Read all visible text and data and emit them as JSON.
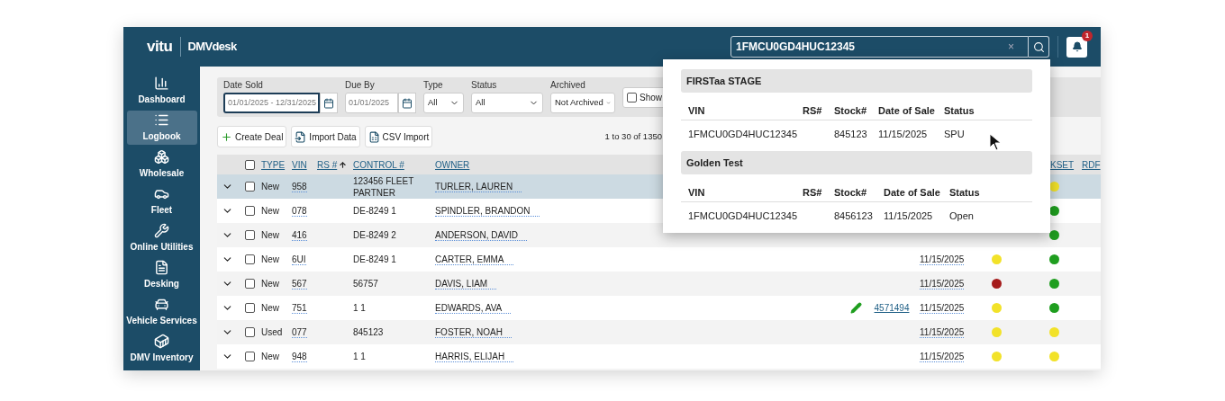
{
  "header": {
    "logo": "vitu",
    "product": "DMVdesk",
    "search": {
      "value": "1FMCU0GD4HUC12345",
      "clear": "×"
    },
    "notifications": {
      "count": "1"
    }
  },
  "sidebar": {
    "items": [
      {
        "label": "Dashboard",
        "selected": false
      },
      {
        "label": "Logbook",
        "selected": true
      },
      {
        "label": "Wholesale",
        "selected": false
      },
      {
        "label": "Fleet",
        "selected": false
      },
      {
        "label": "Online Utilities",
        "selected": false
      },
      {
        "label": "Desking",
        "selected": false
      },
      {
        "label": "Vehicle Services",
        "selected": false
      },
      {
        "label": "DMV Inventory",
        "selected": false
      }
    ]
  },
  "filters": [
    {
      "kind": "date",
      "label": "Date Sold",
      "value": "01/01/2025 - 12/31/2025",
      "focused": true
    },
    {
      "kind": "date",
      "label": "Due By",
      "value": "01/01/2025",
      "focused": false
    },
    {
      "kind": "select",
      "label": "Type",
      "value": "All"
    },
    {
      "kind": "select",
      "label": "Status",
      "value": "All"
    },
    {
      "kind": "select",
      "label": "Archived",
      "value": "Not Archived"
    },
    {
      "kind": "checkbox",
      "label": "Show",
      "checked": false
    }
  ],
  "actions": [
    {
      "label": "Create Deal"
    },
    {
      "label": "Import Data"
    },
    {
      "label": "CSV Import"
    }
  ],
  "pagination": "1 to 30 of 1350",
  "table": {
    "all_checked": false,
    "columns": [
      {
        "label": "TYPE"
      },
      {
        "label": "VIN"
      },
      {
        "label": "RS #",
        "sorted": true
      },
      {
        "label": "CONTROL #"
      },
      {
        "label": "OWNER"
      },
      {
        "label": "KSET"
      },
      {
        "label": "RDF"
      }
    ],
    "rows": [
      {
        "selected": true,
        "checked": false,
        "type": "New",
        "vin": "958",
        "control": "123456 FLEET PARTNER",
        "owner": "TURLER, LAUREN",
        "dot_2": {
          "color": "#f2e229"
        }
      },
      {
        "selected": false,
        "checked": false,
        "type": "New",
        "vin": "078",
        "control": "DE-8249 1",
        "owner": "SPINDLER, BRANDON",
        "dot_2": {
          "color": "#1f9e1f"
        }
      },
      {
        "selected": false,
        "checked": false,
        "type": "New",
        "vin": "416",
        "control": "DE-8249 2",
        "owner": "ANDERSON, DAVID",
        "dot_2": {
          "color": "#1f9e1f"
        }
      },
      {
        "selected": false,
        "checked": false,
        "type": "New",
        "vin": "6UI",
        "control": "DE-8249 1",
        "owner": "CARTER, EMMA",
        "date": "11/15/2025",
        "dot_1": {
          "color": "#f2e229"
        },
        "dot_2": {
          "color": "#1f9e1f"
        }
      },
      {
        "selected": false,
        "checked": false,
        "type": "New",
        "vin": "567",
        "control": "56757",
        "owner": "DAVIS, LIAM",
        "date": "11/15/2025",
        "dot_1": {
          "color": "#a51b1b"
        },
        "dot_2": {
          "color": "#1f9e1f"
        }
      },
      {
        "selected": false,
        "checked": false,
        "type": "New",
        "vin": "751",
        "control": "1 1",
        "owner": "EDWARDS, AVA",
        "editable": true,
        "link": "4571494",
        "date": "11/15/2025",
        "dot_1": {
          "color": "#f2e229"
        },
        "dot_2": {
          "color": "#1f9e1f"
        }
      },
      {
        "selected": false,
        "checked": false,
        "type": "Used",
        "vin": "077",
        "control": "845123",
        "owner": "FOSTER, NOAH",
        "date": "11/15/2025",
        "dot_1": {
          "color": "#f2e229"
        },
        "dot_2": {
          "color": "#f2e229"
        }
      },
      {
        "selected": false,
        "checked": false,
        "type": "New",
        "vin": "948",
        "control": "1 1",
        "owner": "HARRIS, ELIJAH",
        "date": "11/15/2025",
        "dot_1": {
          "color": "#f2e229"
        },
        "dot_2": {
          "color": "#f2e229"
        }
      }
    ]
  },
  "search_results": [
    {
      "title": "FIRSTaa STAGE",
      "columns": [
        "VIN",
        "RS#",
        "Stock#",
        "Date of Sale",
        "Status"
      ],
      "row": {
        "vin": "1FMCU0GD4HUC12345",
        "stock": "845123",
        "date": "11/15/2025",
        "status": "SPU"
      }
    },
    {
      "title": "Golden Test",
      "columns": [
        "VIN",
        "RS#",
        "Stock#",
        "Date of Sale",
        "Status"
      ],
      "row": {
        "vin": "1FMCU0GD4HUC12345",
        "stock": "8456123",
        "date": "11/15/2025",
        "status": "Open"
      }
    }
  ]
}
